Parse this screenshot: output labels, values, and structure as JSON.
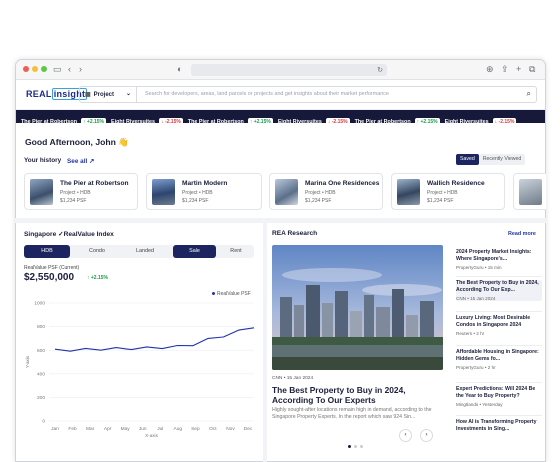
{
  "colors": {
    "brand_navy": "#1d2560",
    "ticker_bg": "#16193a",
    "up": "#1a9a4a",
    "down": "#d43a3a",
    "link": "#2436a8",
    "line": "#2233aa"
  },
  "search": {
    "scope": "Project",
    "placeholder": "Search for developers, areas, land parcels or projects and get insights about their market performance"
  },
  "logo": {
    "part1": "REAL",
    "part2": "insight"
  },
  "ticker": [
    {
      "name": "The Pier at Robertson",
      "change": "+2.15%",
      "dir": "up"
    },
    {
      "name": "Eight Riversuites",
      "change": "-2.15%",
      "dir": "down"
    },
    {
      "name": "The Pier at Robertson",
      "change": "+2.15%",
      "dir": "up"
    },
    {
      "name": "Eight Riversuites",
      "change": "-2.15%",
      "dir": "down"
    },
    {
      "name": "The Pier at Robertson",
      "change": "+2.15%",
      "dir": "up"
    },
    {
      "name": "Eight Riversuites",
      "change": "-2.15%",
      "dir": "down"
    }
  ],
  "greeting": "Good Afternoon, John 👋",
  "history": {
    "title": "Your history",
    "see_all": "See all ↗",
    "toggle_saved": "Saved",
    "toggle_recent": "Recently Viewed",
    "items": [
      {
        "name": "The Pier at Robertson",
        "sub": "Project • HDB",
        "price": "$1,234 PSF"
      },
      {
        "name": "Martin Modern",
        "sub": "Project • HDB",
        "price": "$1,234 PSF"
      },
      {
        "name": "Marina One Residences",
        "sub": "Project • HDB",
        "price": "$1,234 PSF"
      },
      {
        "name": "Wallich Residence",
        "sub": "Project • HDB",
        "price": "$1,234 PSF"
      }
    ]
  },
  "index": {
    "title": "Singapore ✓RealValue Index",
    "tabs_type": [
      "HDB",
      "Condo",
      "Landed"
    ],
    "tabs_mode": [
      "Sale",
      "Rent"
    ],
    "label": "RealValue PSF (Current)",
    "value": "$2,550,000",
    "change": "↑ +2.15%",
    "legend": "RealValue PSF"
  },
  "chart_data": {
    "type": "line",
    "x": [
      "Jan",
      "Feb",
      "Mar",
      "Apr",
      "May",
      "Jun",
      "Jul",
      "Aug",
      "Sep",
      "Oct",
      "Nov",
      "Dec"
    ],
    "series": [
      {
        "name": "RealValue PSF",
        "values": [
          598,
          602,
          605,
          610,
          612,
          615,
          618,
          624,
          630,
          648,
          690,
          722,
          760,
          800
        ]
      }
    ],
    "xlabel": "X-axis",
    "ylabel": "Y-axis",
    "ylim": [
      0,
      1000
    ],
    "yticks": [
      0,
      200,
      400,
      600,
      800,
      1000
    ],
    "grid": true,
    "legend": "top-right"
  },
  "research": {
    "title": "REA Research",
    "read_more": "Read more",
    "main": {
      "source": "CNN  •  15 Jan 2024",
      "headline": "The Best Property to Buy in 2024, According To Our Experts",
      "excerpt": "Highly sought-after locations remain high in demand, according to the Singapore Property Experts. In the report which saw 924 Sin..."
    },
    "side": [
      {
        "title": "2024 Property Market Insights: Where Singapore's...",
        "meta": "PropertyGuru  •  15 min"
      },
      {
        "title": "The Best Property to Buy in 2024, According To Our Exp...",
        "meta": "CNN  •  15 Jan 2024"
      },
      {
        "title": "Luxury Living: Most Desirable Condos in Singapore 2024",
        "meta": "Reuters  •  2 hr"
      },
      {
        "title": "Affordable Housing in Singapore: Hidden Gems fo...",
        "meta": "PropertyGuru  •  2 hr"
      },
      {
        "title": "Expert Predictions: Will 2024 Be the Year to Buy Property?",
        "meta": "Mingtlands  •  Yesterday"
      },
      {
        "title": "How AI is Transforming Property Investments in Sing...",
        "meta": ""
      }
    ]
  }
}
